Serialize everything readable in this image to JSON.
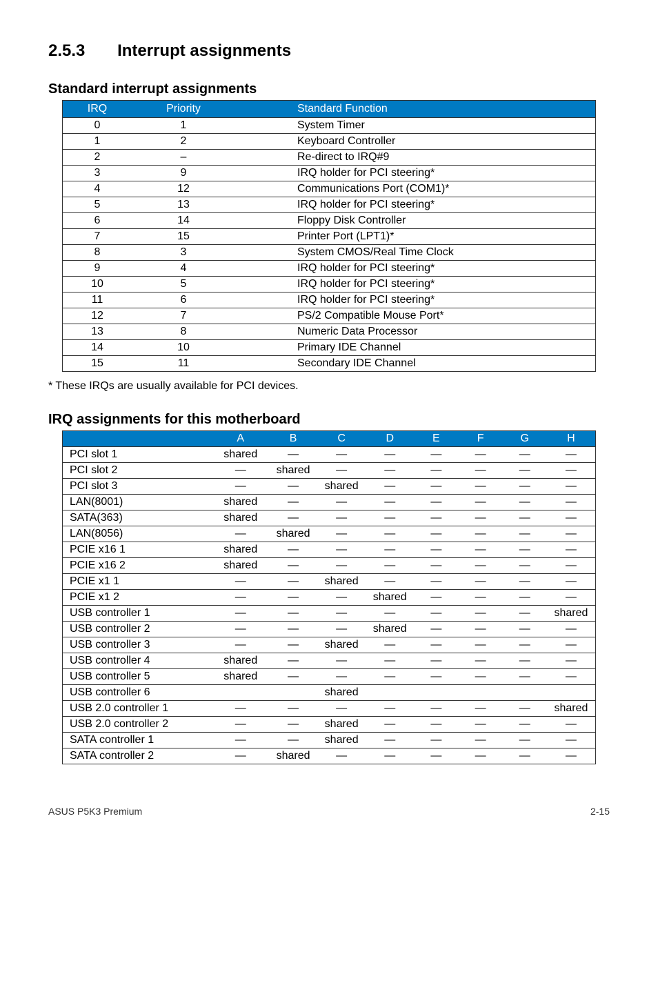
{
  "section": {
    "number": "2.5.3",
    "title": "Interrupt assignments"
  },
  "table1": {
    "heading": "Standard interrupt assignments",
    "headers": {
      "irq": "IRQ",
      "priority": "Priority",
      "func": "Standard Function"
    },
    "rows": [
      {
        "irq": "0",
        "priority": "1",
        "func": "System Timer"
      },
      {
        "irq": "1",
        "priority": "2",
        "func": "Keyboard Controller"
      },
      {
        "irq": "2",
        "priority": "–",
        "func": "Re-direct to IRQ#9"
      },
      {
        "irq": "3",
        "priority": "9",
        "func": "IRQ holder for PCI steering*"
      },
      {
        "irq": "4",
        "priority": "12",
        "func": "Communications Port (COM1)*"
      },
      {
        "irq": "5",
        "priority": "13",
        "func": "IRQ holder for PCI steering*"
      },
      {
        "irq": "6",
        "priority": "14",
        "func": "Floppy Disk Controller"
      },
      {
        "irq": "7",
        "priority": "15",
        "func": "Printer Port (LPT1)*"
      },
      {
        "irq": "8",
        "priority": "3",
        "func": "System CMOS/Real Time Clock"
      },
      {
        "irq": "9",
        "priority": "4",
        "func": "IRQ holder for PCI steering*"
      },
      {
        "irq": "10",
        "priority": "5",
        "func": "IRQ holder for PCI steering*"
      },
      {
        "irq": "11",
        "priority": "6",
        "func": "IRQ holder for PCI steering*"
      },
      {
        "irq": "12",
        "priority": "7",
        "func": "PS/2 Compatible Mouse Port*"
      },
      {
        "irq": "13",
        "priority": "8",
        "func": "Numeric Data Processor"
      },
      {
        "irq": "14",
        "priority": "10",
        "func": "Primary IDE Channel"
      },
      {
        "irq": "15",
        "priority": "11",
        "func": "Secondary IDE Channel"
      }
    ]
  },
  "footnote": "* These IRQs are usually available for PCI devices.",
  "table2": {
    "heading": "IRQ assignments for this motherboard",
    "headers": {
      "blank": "",
      "a": "A",
      "b": "B",
      "c": "C",
      "d": "D",
      "e": "E",
      "f": "F",
      "g": "G",
      "h": "H"
    },
    "rows": [
      {
        "label": "PCI slot 1",
        "a": "shared",
        "b": "—",
        "c": "—",
        "d": "—",
        "e": "—",
        "f": "—",
        "g": "—",
        "h": "—"
      },
      {
        "label": "PCI slot 2",
        "a": "—",
        "b": "shared",
        "c": "—",
        "d": "—",
        "e": "—",
        "f": "—",
        "g": "—",
        "h": "—"
      },
      {
        "label": "PCI slot 3",
        "a": "—",
        "b": "—",
        "c": "shared",
        "d": "—",
        "e": "—",
        "f": "—",
        "g": "—",
        "h": "—"
      },
      {
        "label": "LAN(8001)",
        "a": "shared",
        "b": "—",
        "c": "—",
        "d": "—",
        "e": "—",
        "f": "—",
        "g": "—",
        "h": "—"
      },
      {
        "label": "SATA(363)",
        "a": "shared",
        "b": "—",
        "c": "—",
        "d": "—",
        "e": "—",
        "f": "—",
        "g": "—",
        "h": "—"
      },
      {
        "label": "LAN(8056)",
        "a": "—",
        "b": "shared",
        "c": "—",
        "d": "—",
        "e": "—",
        "f": "—",
        "g": "—",
        "h": "—"
      },
      {
        "label": "PCIE x16 1",
        "a": "shared",
        "b": "—",
        "c": "—",
        "d": "—",
        "e": "—",
        "f": "—",
        "g": "—",
        "h": "—"
      },
      {
        "label": "PCIE x16 2",
        "a": "shared",
        "b": "—",
        "c": "—",
        "d": "—",
        "e": "—",
        "f": "—",
        "g": "—",
        "h": "—"
      },
      {
        "label": "PCIE x1 1",
        "a": "—",
        "b": "—",
        "c": "shared",
        "d": "—",
        "e": "—",
        "f": "—",
        "g": "—",
        "h": "—"
      },
      {
        "label": "PCIE x1 2",
        "a": "—",
        "b": "—",
        "c": "—",
        "d": "shared",
        "e": "—",
        "f": "—",
        "g": "—",
        "h": "—"
      },
      {
        "label": "USB controller 1",
        "a": "—",
        "b": "—",
        "c": "—",
        "d": "—",
        "e": "—",
        "f": "—",
        "g": "—",
        "h": "shared"
      },
      {
        "label": "USB controller 2",
        "a": "—",
        "b": "—",
        "c": "—",
        "d": "shared",
        "e": "—",
        "f": "—",
        "g": "—",
        "h": "—"
      },
      {
        "label": "USB controller 3",
        "a": "—",
        "b": "—",
        "c": "shared",
        "d": "—",
        "e": "—",
        "f": "—",
        "g": "—",
        "h": "—"
      },
      {
        "label": "USB controller 4",
        "a": "shared",
        "b": "—",
        "c": "—",
        "d": "—",
        "e": "—",
        "f": "—",
        "g": "—",
        "h": "—"
      },
      {
        "label": "USB controller 5",
        "a": "shared",
        "b": "—",
        "c": "—",
        "d": "—",
        "e": "—",
        "f": "—",
        "g": "—",
        "h": "—"
      },
      {
        "label": "USB controller 6",
        "a": "",
        "b": "",
        "c": "shared",
        "d": "",
        "e": "",
        "f": "",
        "g": "",
        "h": ""
      },
      {
        "label": "USB 2.0 controller 1",
        "a": "—",
        "b": "—",
        "c": "—",
        "d": "—",
        "e": "—",
        "f": "—",
        "g": "—",
        "h": "shared"
      },
      {
        "label": "USB 2.0 controller 2",
        "a": "—",
        "b": "—",
        "c": "shared",
        "d": "—",
        "e": "—",
        "f": "—",
        "g": "—",
        "h": "—"
      },
      {
        "label": "SATA controller 1",
        "a": "—",
        "b": "—",
        "c": "shared",
        "d": "—",
        "e": "—",
        "f": "—",
        "g": "—",
        "h": "—"
      },
      {
        "label": "SATA controller 2",
        "a": "—",
        "b": "shared",
        "c": "—",
        "d": "—",
        "e": "—",
        "f": "—",
        "g": "—",
        "h": "—"
      }
    ]
  },
  "footer": {
    "left": "ASUS P5K3 Premium",
    "right": "2-15"
  }
}
